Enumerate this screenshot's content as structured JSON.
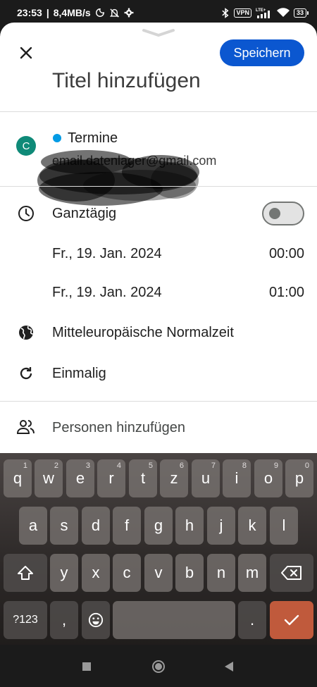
{
  "status_bar": {
    "time": "23:53",
    "network_speed": "8,4MB/s",
    "vpn": "VPN",
    "network_type": "LTE+",
    "battery": "33"
  },
  "header": {
    "save_label": "Speichern",
    "title_placeholder": "Titel hinzufügen"
  },
  "account": {
    "avatar_letter": "C",
    "calendar_name": "Termine",
    "email": "email.datenlager@gmail.com"
  },
  "event": {
    "all_day_label": "Ganztägig",
    "all_day_on": false,
    "start_date": "Fr., 19. Jan. 2024",
    "start_time": "00:00",
    "end_date": "Fr., 19. Jan. 2024",
    "end_time": "01:00",
    "timezone": "Mitteleuropäische Normalzeit",
    "repeat": "Einmalig",
    "add_people": "Personen hinzufügen"
  },
  "keyboard": {
    "row1": [
      {
        "k": "q",
        "h": "1"
      },
      {
        "k": "w",
        "h": "2"
      },
      {
        "k": "e",
        "h": "3"
      },
      {
        "k": "r",
        "h": "4"
      },
      {
        "k": "t",
        "h": "5"
      },
      {
        "k": "z",
        "h": "6"
      },
      {
        "k": "u",
        "h": "7"
      },
      {
        "k": "i",
        "h": "8"
      },
      {
        "k": "o",
        "h": "9"
      },
      {
        "k": "p",
        "h": "0"
      }
    ],
    "row2": [
      "a",
      "s",
      "d",
      "f",
      "g",
      "h",
      "j",
      "k",
      "l"
    ],
    "row3": [
      "y",
      "x",
      "c",
      "v",
      "b",
      "n",
      "m"
    ],
    "symbols_label": "?123",
    "comma": ",",
    "period": "."
  },
  "colors": {
    "accent": "#0b57d0",
    "avatar": "#0f8a78",
    "calendar_dot": "#039be5",
    "enter_key": "#c05a3c"
  }
}
